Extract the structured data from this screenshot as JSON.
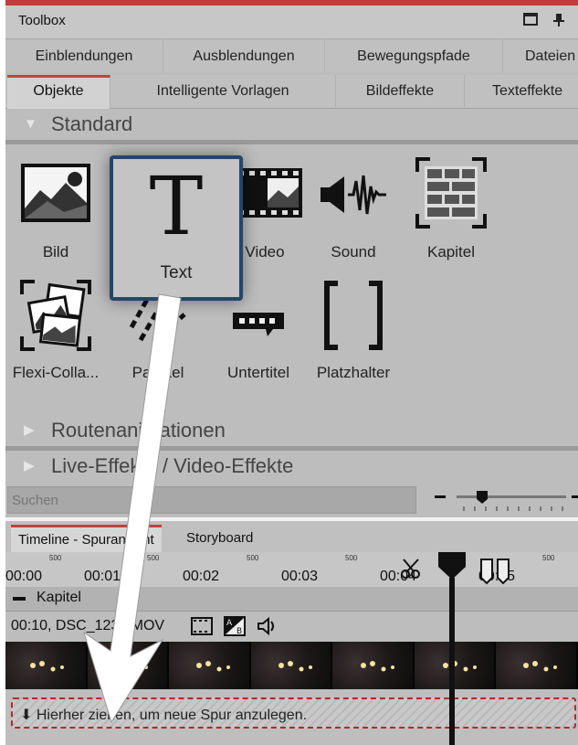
{
  "window": {
    "title": "Toolbox"
  },
  "tabs_row1": [
    "Einblendungen",
    "Ausblendungen",
    "Bewegungspfade",
    "Dateien"
  ],
  "tabs_row2": [
    "Objekte",
    "Intelligente Vorlagen",
    "Bildeffekte",
    "Texteffekte"
  ],
  "active_tab": "Objekte",
  "sections": {
    "standard": "Standard",
    "routen": "Routenanimationen",
    "live": "Live-Effekte / Video-Effekte"
  },
  "objects": {
    "bild": "Bild",
    "text": "Text",
    "video": "Video",
    "sound": "Sound",
    "kapitel": "Kapitel",
    "flexi": "Flexi-Colla...",
    "partikel": "Partikel",
    "untertitel": "Untertitel",
    "platzhalter": "Platzhalter"
  },
  "search": {
    "placeholder": "Suchen"
  },
  "timeline": {
    "tabs": [
      "Timeline - Spuransicht",
      "Storyboard"
    ],
    "times": [
      "00:00",
      "00:01",
      "00:02",
      "00:03",
      "00:04",
      "00:05"
    ],
    "sub_ticks": [
      "500",
      "500",
      "500",
      "500",
      "500",
      "500"
    ],
    "chapter_label": "Kapitel",
    "clip_info": "00:10,  DSC_1234.MOV",
    "drop_hint": "Hierher ziehen, um neue Spur anzulegen."
  },
  "colors": {
    "accent": "#c53a3a",
    "highlight_border": "#23466b"
  }
}
